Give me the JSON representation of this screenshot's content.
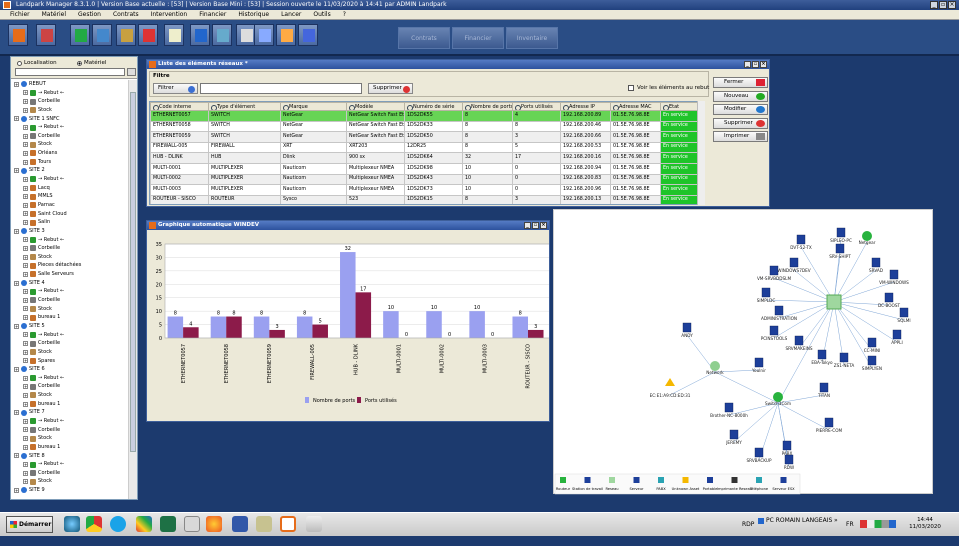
{
  "app": {
    "title": "Landpark Manager 8.3.1.0   |   Version Base actuelle : [53]   |   Version Base Mini : [53]   |   Session ouverte le 11/03/2020 à 14:41 par ADMIN Landpark",
    "menu": [
      "Fichier",
      "Matériel",
      "Gestion",
      "Contrats",
      "Intervention",
      "Financier",
      "Historique",
      "Lancer",
      "Outils",
      "?"
    ],
    "toolbar_tabs": [
      "Contrats",
      "Financier",
      "Inventaire"
    ]
  },
  "left_panel": {
    "radio_localisation": "Localisation",
    "radio_materiel": "Matériel",
    "tree": [
      {
        "level": 0,
        "label": "REBUT",
        "icon": "globe"
      },
      {
        "level": 1,
        "label": "→ Rebut ←",
        "icon": "recycle"
      },
      {
        "level": 1,
        "label": "Corbeille",
        "icon": "trash"
      },
      {
        "level": 1,
        "label": "Stock",
        "icon": "box"
      },
      {
        "level": 0,
        "label": "SITE 1 SNFC",
        "icon": "globe"
      },
      {
        "level": 1,
        "label": "→ Rebut ←",
        "icon": "recycle"
      },
      {
        "level": 1,
        "label": "Corbeille",
        "icon": "trash"
      },
      {
        "level": 1,
        "label": "Stock",
        "icon": "box"
      },
      {
        "level": 1,
        "label": "Orléans",
        "icon": "place"
      },
      {
        "level": 1,
        "label": "Tours",
        "icon": "place"
      },
      {
        "level": 0,
        "label": "SITE 2",
        "icon": "globe"
      },
      {
        "level": 1,
        "label": "→ Rebut ←",
        "icon": "recycle"
      },
      {
        "level": 1,
        "label": "Lacq",
        "icon": "place"
      },
      {
        "level": 1,
        "label": "MMLS",
        "icon": "place"
      },
      {
        "level": 1,
        "label": "Parnac",
        "icon": "place"
      },
      {
        "level": 1,
        "label": "Saint Cloud",
        "icon": "place"
      },
      {
        "level": 1,
        "label": "Salin",
        "icon": "place"
      },
      {
        "level": 0,
        "label": "SITE 3",
        "icon": "globe"
      },
      {
        "level": 1,
        "label": "→ Rebut ←",
        "icon": "recycle"
      },
      {
        "level": 1,
        "label": "Corbeille",
        "icon": "trash"
      },
      {
        "level": 1,
        "label": "Stock",
        "icon": "box"
      },
      {
        "level": 1,
        "label": "Pieces détachées",
        "icon": "place"
      },
      {
        "level": 1,
        "label": "Salle Serveurs",
        "icon": "place"
      },
      {
        "level": 0,
        "label": "SITE 4",
        "icon": "globe"
      },
      {
        "level": 1,
        "label": "→ Rebut ←",
        "icon": "recycle"
      },
      {
        "level": 1,
        "label": "Corbeille",
        "icon": "trash"
      },
      {
        "level": 1,
        "label": "Stock",
        "icon": "box"
      },
      {
        "level": 1,
        "label": "bureau 1",
        "icon": "place"
      },
      {
        "level": 0,
        "label": "SITE 5",
        "icon": "globe"
      },
      {
        "level": 1,
        "label": "→ Rebut ←",
        "icon": "recycle"
      },
      {
        "level": 1,
        "label": "Corbeille",
        "icon": "trash"
      },
      {
        "level": 1,
        "label": "Stock",
        "icon": "box"
      },
      {
        "level": 1,
        "label": "Spares",
        "icon": "place"
      },
      {
        "level": 0,
        "label": "SITE 6",
        "icon": "globe"
      },
      {
        "level": 1,
        "label": "→ Rebut ←",
        "icon": "recycle"
      },
      {
        "level": 1,
        "label": "Corbeille",
        "icon": "trash"
      },
      {
        "level": 1,
        "label": "Stock",
        "icon": "box"
      },
      {
        "level": 1,
        "label": "bureau 1",
        "icon": "place"
      },
      {
        "level": 0,
        "label": "SITE 7",
        "icon": "globe"
      },
      {
        "level": 1,
        "label": "→ Rebut ←",
        "icon": "recycle"
      },
      {
        "level": 1,
        "label": "Corbeille",
        "icon": "trash"
      },
      {
        "level": 1,
        "label": "Stock",
        "icon": "box"
      },
      {
        "level": 1,
        "label": "bureau 1",
        "icon": "place"
      },
      {
        "level": 0,
        "label": "SITE 8",
        "icon": "globe"
      },
      {
        "level": 1,
        "label": "→ Rebut ←",
        "icon": "recycle"
      },
      {
        "level": 1,
        "label": "Corbeille",
        "icon": "trash"
      },
      {
        "level": 1,
        "label": "Stock",
        "icon": "box"
      },
      {
        "level": 0,
        "label": "SITE 9",
        "icon": "globe"
      }
    ]
  },
  "list_window": {
    "title": "Liste des éléments réseaux *",
    "filter_group": "Filtre",
    "filter_button": "Filtrer",
    "delete_filter_button": "Supprimer",
    "show_rebut": "Voir les éléments au rebut",
    "columns": [
      "Code interne",
      "Type d'élément",
      "Marque",
      "Modèle",
      "Numéro de série",
      "Nombre de ports",
      "Ports utilisés",
      "Adresse IP",
      "Adresse MAC",
      "Etat"
    ],
    "rows": [
      [
        "ETHERNET0057",
        "SWITCH",
        "NetGear",
        "NetGear Switch Fast Ethernet 8",
        "1DS2DK55",
        "8",
        "4",
        "192.168.200.89",
        "01.5E.76.98.8E",
        "En service"
      ],
      [
        "ETHERNET0058",
        "SWITCH",
        "NetGear",
        "NetGear Switch Fast Ethernet 8",
        "1DS2DK33",
        "8",
        "8",
        "192.168.200.46",
        "01.5E.76.98.8E",
        "En service"
      ],
      [
        "ETHERNET0059",
        "SWITCH",
        "NetGear",
        "NetGear Switch Fast Ethernet 8",
        "1DS2DK50",
        "8",
        "3",
        "192.168.200.66",
        "01.5E.76.98.8E",
        "En service"
      ],
      [
        "FIREWALL-005",
        "FIREWALL",
        "XRT",
        "XRT203",
        "12DR25",
        "8",
        "5",
        "192.168.200.53",
        "01.5E.76.98.8E",
        "En service"
      ],
      [
        "HUB - DLINK",
        "HUB",
        "Dlink",
        "900 sx",
        "1DS2DK64",
        "32",
        "17",
        "192.168.200.16",
        "01.5E.76.98.8E",
        "En service"
      ],
      [
        "MULTI-0001",
        "MULTIPLEXER",
        "Nauticom",
        "Multiplexeur NMEA",
        "1DS2DK98",
        "10",
        "0",
        "192.168.200.94",
        "01.5E.76.98.8E",
        "En service"
      ],
      [
        "MULTI-0002",
        "MULTIPLEXER",
        "Nauticom",
        "Multiplexeur NMEA",
        "1DS2DK43",
        "10",
        "0",
        "192.168.200.83",
        "01.5E.76.98.8E",
        "En service"
      ],
      [
        "MULTI-0003",
        "MULTIPLEXER",
        "Nauticom",
        "Multiplexeur NMEA",
        "1DS2DK73",
        "10",
        "0",
        "192.168.200.96",
        "01.5E.76.98.8E",
        "En service"
      ],
      [
        "ROUTEUR - SISCO",
        "ROUTEUR",
        "Sysco",
        "523",
        "1DS2DK15",
        "8",
        "3",
        "192.168.200.13",
        "01.5E.76.98.8E",
        "En service"
      ]
    ],
    "buttons": {
      "close": "Fermer",
      "new": "Nouveau",
      "edit": "Modifier",
      "delete": "Supprimer",
      "print": "Imprimer"
    }
  },
  "chart_window": {
    "title": "Graphique automatique WINDEV"
  },
  "chart_data": {
    "type": "bar",
    "categories": [
      "ETHERNET0057",
      "ETHERNET0058",
      "ETHERNET0059",
      "FIREWALL-005",
      "HUB - DLINK",
      "MULTI-0001",
      "MULTI-0002",
      "MULTI-0003",
      "ROUTEUR - SISCO"
    ],
    "series": [
      {
        "name": "Nombre de ports",
        "color": "#9aa0f0",
        "values": [
          8,
          8,
          8,
          8,
          32,
          10,
          10,
          10,
          8
        ]
      },
      {
        "name": "Ports utilisés",
        "color": "#8c1b4a",
        "values": [
          4,
          8,
          3,
          5,
          17,
          0,
          0,
          0,
          3
        ]
      }
    ],
    "yticks": [
      0,
      5,
      10,
      15,
      20,
      25,
      30,
      35
    ],
    "ylim": [
      0,
      35
    ],
    "grid": true,
    "legend": "bottom"
  },
  "network": {
    "nodes": [
      "SIPLEO-PC",
      "DVT-52-TX",
      "Netgear",
      "SRV-SHIPT",
      "WINDOWS7DEV",
      "SRVAD",
      "VM-WINDOWS",
      "VM-SRVBDDSLM",
      "SIMPLDC",
      "DC-BOOST",
      "ADMINISTRATION",
      "SQLMI",
      "PCINSTOOLS",
      "SRVMAKEINS",
      "CC-MINI",
      "APPLI",
      "EBA-Tokyo",
      "ZS1-NETA",
      "SIMPLYEN",
      "Network",
      "ANDY",
      "EC:E1:A9:CD:ED:31",
      "Youlnir",
      "Switch3Com",
      "TITAN",
      "Brother-NC-8000h",
      "PIERRE-COM",
      "JEREMY",
      "SRVBACKUP",
      "PABX",
      "RDW"
    ],
    "legend": [
      "Routeur",
      "Station de travail",
      "Reseau",
      "Serveur",
      "PABX",
      "Unknown Asset",
      "Portable",
      "Imprimante Reseau",
      "Téléphone",
      "Serveur ESX"
    ]
  },
  "taskbar": {
    "start": "Démarrer",
    "rdp": "RDP",
    "user": "PC ROMAIN LANGEAIS",
    "lang": "FR",
    "time": "14:44",
    "date": "11/03/2020"
  }
}
